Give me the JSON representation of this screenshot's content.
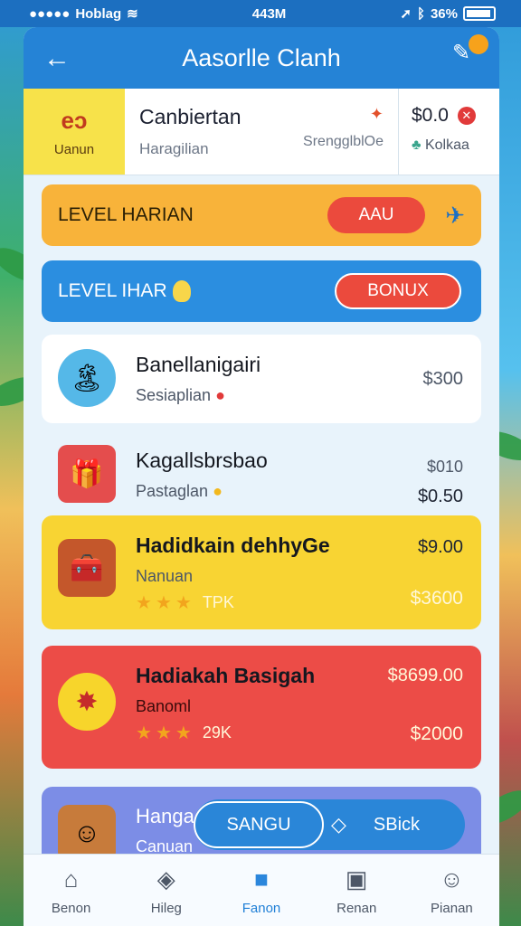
{
  "status_bar": {
    "carrier": "Hoblag",
    "time": "443M",
    "battery": "36%"
  },
  "header": {
    "title": "Aasorlle Clanh"
  },
  "profile": {
    "icon_glyph": "eɔ",
    "icon_label": "Uanun",
    "name": "Canbiertan",
    "subtitle": "Haragilian",
    "stat": "SrengglblOe",
    "balance": "$0.0",
    "sub_stat": "Kolkaa"
  },
  "levels": [
    {
      "label": "LEVEL HARIAN",
      "button": "AAU"
    },
    {
      "label": "LEVEL IHAR",
      "button": "BONUX"
    }
  ],
  "items": [
    {
      "title": "Banellanigairi",
      "subtitle": "Sesiaplian",
      "price": "$300"
    },
    {
      "title": "Kagallsbrsbao",
      "subtitle": "Pastaglan",
      "price": "$010",
      "price2": "$0.50"
    },
    {
      "title": "Hadidkain dehhyGe",
      "subtitle": "Nanuan",
      "price": "$9.00",
      "price2": "$3600",
      "rating_text": "TPK",
      "rating": 3
    },
    {
      "title": "Hadiakah Basigah",
      "subtitle": "Banoml",
      "price": "$8699.00",
      "price2": "$2000",
      "rating_text": "29K",
      "rating": 3
    },
    {
      "title": "Hanga",
      "subtitle": "Canuan"
    }
  ],
  "action_bar": {
    "left_label": "SANGU",
    "right_label": "SBick"
  },
  "nav": [
    {
      "label": "Benon",
      "icon": "home-icon"
    },
    {
      "label": "Hileg",
      "icon": "bag-icon"
    },
    {
      "label": "Fanon",
      "icon": "folder-icon"
    },
    {
      "label": "Renan",
      "icon": "card-icon"
    },
    {
      "label": "Pianan",
      "icon": "user-icon"
    }
  ],
  "colors": {
    "header": "#2583d6",
    "level1": "#f8b33a",
    "level2": "#2b8ee0",
    "item3": "#f8d433",
    "item4": "#ec4c47",
    "item5": "#7c8de6"
  }
}
